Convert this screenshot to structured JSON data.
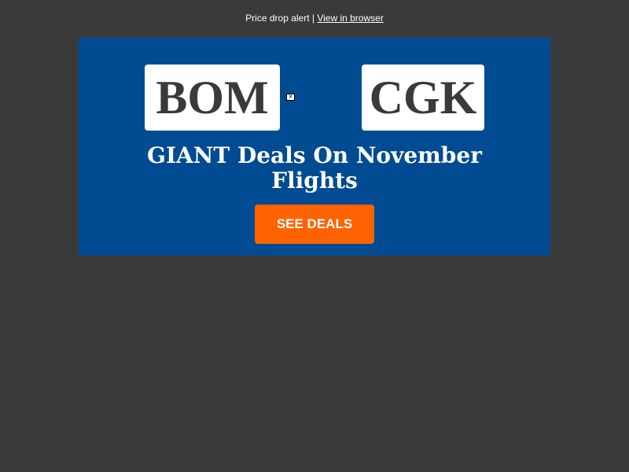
{
  "preheader": {
    "text": "Price drop alert | ",
    "link_label": "View in browser"
  },
  "banner": {
    "origin_code": "BOM",
    "destination_code": "CGK",
    "arrow_icon": "broken-image-icon",
    "headline": "GIANT Deals On November Flights",
    "cta_label": "SEE DEALS"
  },
  "colors": {
    "page_background": "#3a3a3a",
    "banner_background": "#004b91",
    "cta_background": "#ff6200",
    "code_text": "#3a3a3a"
  }
}
